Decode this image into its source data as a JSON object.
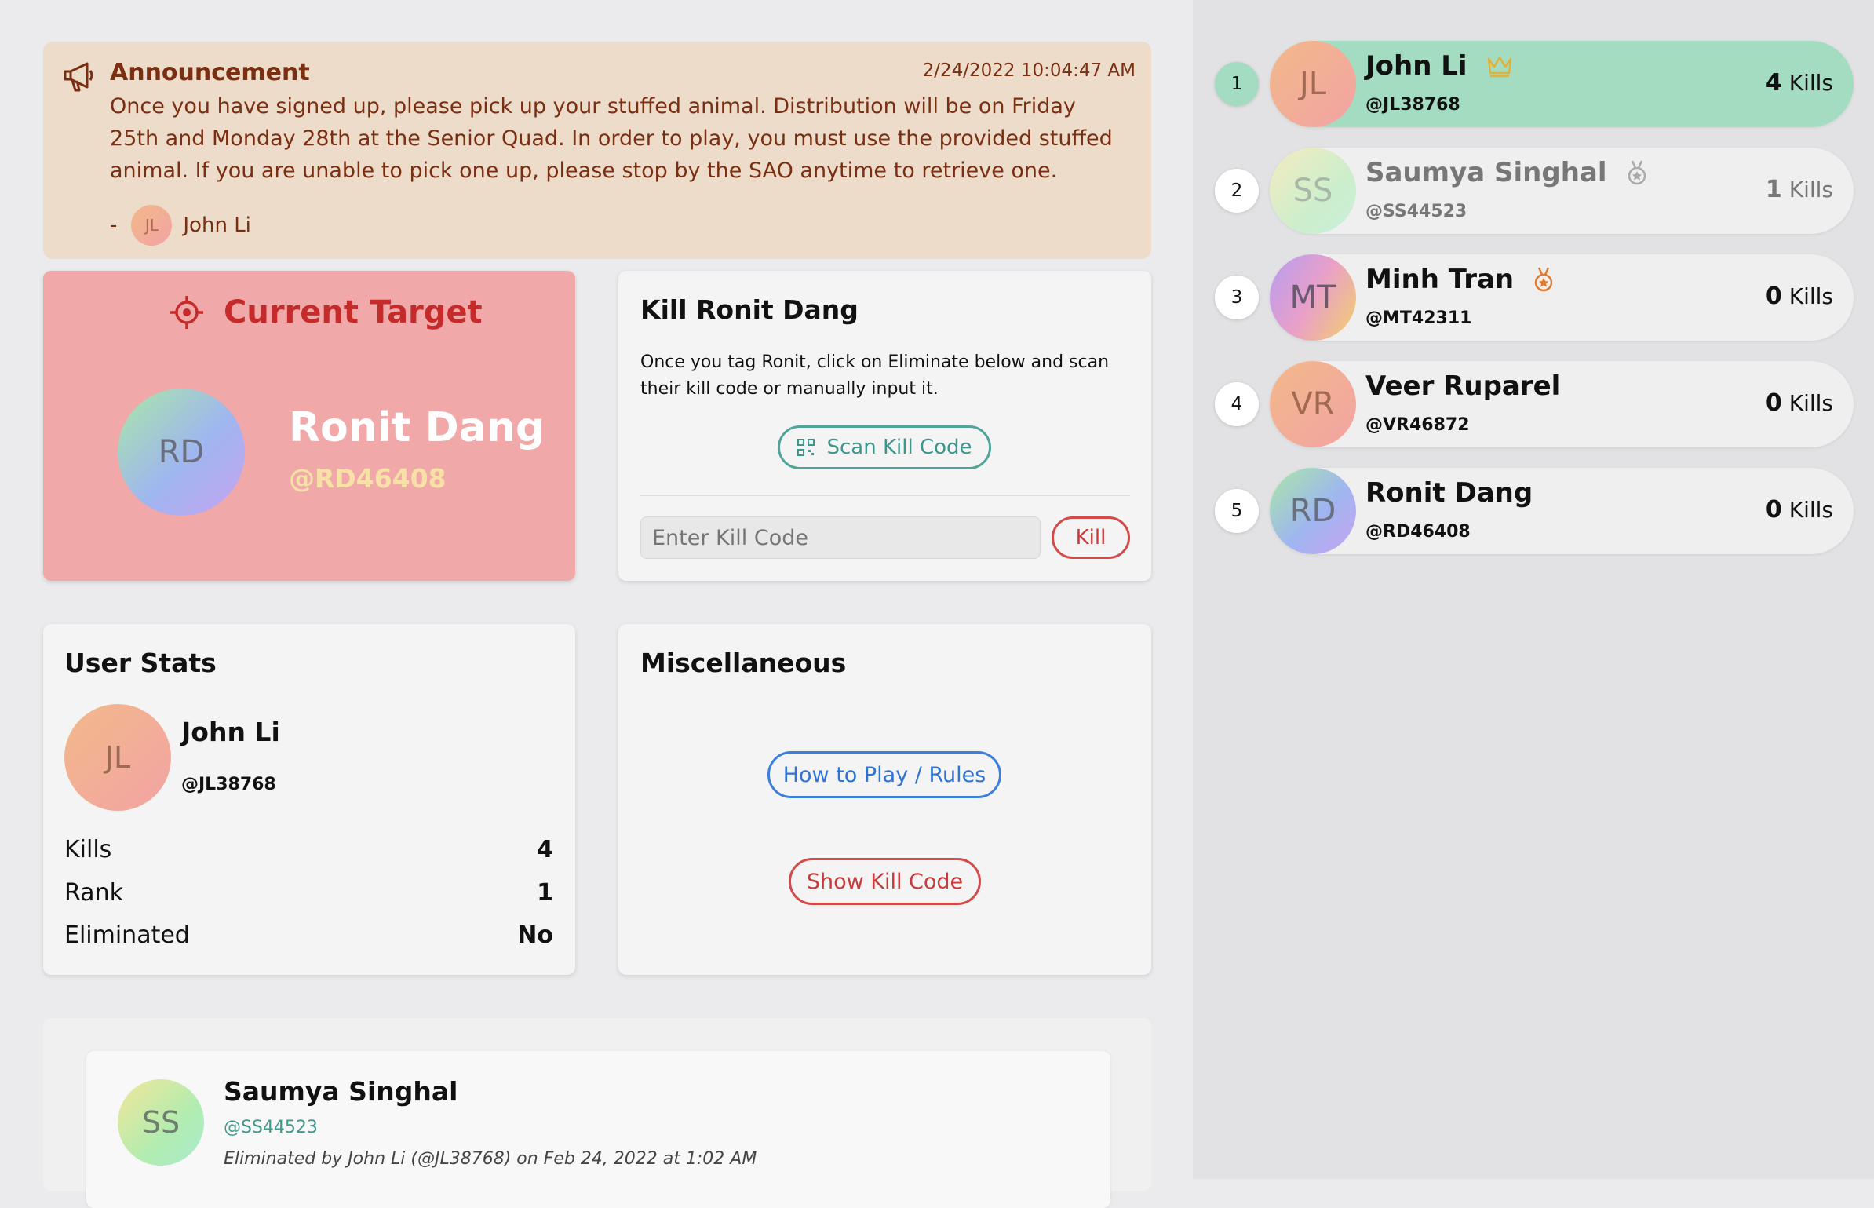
{
  "announcement": {
    "title": "Announcement",
    "date": "2/24/2022 10:04:47 AM",
    "body": "Once you have signed up, please pick up your stuffed animal. Distribution will be on Friday 25th and Monday 28th at the Senior Quad. In order to play, you must use the provided stuffed animal. If you are unable to pick one up, please stop by the SAO anytime to retrieve one.",
    "author_dash": "-",
    "author_initials": "JL",
    "author_name": "John Li"
  },
  "target": {
    "header": "Current Target",
    "initials": "RD",
    "name": "Ronit Dang",
    "handle": "@RD46408"
  },
  "kill": {
    "title": "Kill Ronit Dang",
    "instructions": "Once you tag Ronit, click on Eliminate below and scan their kill code or manually input it.",
    "scan_label": "Scan Kill Code",
    "input_placeholder": "Enter Kill Code",
    "kill_label": "Kill"
  },
  "stats": {
    "title": "User Stats",
    "initials": "JL",
    "name": "John Li",
    "handle": "@JL38768",
    "rows": [
      {
        "label": "Kills",
        "value": "4"
      },
      {
        "label": "Rank",
        "value": "1"
      },
      {
        "label": "Eliminated",
        "value": "No"
      }
    ]
  },
  "misc": {
    "title": "Miscellaneous",
    "rules_label": "How to Play / Rules",
    "show_kill_code_label": "Show Kill Code"
  },
  "feed": {
    "items": [
      {
        "initials": "SS",
        "name": "Saumya Singhal",
        "handle": "@SS44523",
        "description": "Eliminated by John Li (@JL38768) on Feb 24, 2022 at 1:02 AM"
      }
    ]
  },
  "leaderboard": [
    {
      "rank": "1",
      "initials": "JL",
      "name": "John Li",
      "handle": "@JL38768",
      "kills": "4",
      "kills_label": "Kills",
      "icon": "crown-icon",
      "highlight": true
    },
    {
      "rank": "2",
      "initials": "SS",
      "name": "Saumya Singhal",
      "handle": "@SS44523",
      "kills": "1",
      "kills_label": "Kills",
      "icon": "silver-medal-icon",
      "faded": true
    },
    {
      "rank": "3",
      "initials": "MT",
      "name": "Minh Tran",
      "handle": "@MT42311",
      "kills": "0",
      "kills_label": "Kills",
      "icon": "bronze-medal-icon"
    },
    {
      "rank": "4",
      "initials": "VR",
      "name": "Veer Ruparel",
      "handle": "@VR46872",
      "kills": "0",
      "kills_label": "Kills",
      "icon": ""
    },
    {
      "rank": "5",
      "initials": "RD",
      "name": "Ronit Dang",
      "handle": "@RD46408",
      "kills": "0",
      "kills_label": "Kills",
      "icon": ""
    }
  ],
  "colors": {
    "target_bg": "#f0a8a8",
    "target_accent": "#c62b2b",
    "leader_highlight": "#a4dcc2",
    "teal": "#4fa59a",
    "blue": "#3a7fe0",
    "red": "#d34a4a"
  }
}
